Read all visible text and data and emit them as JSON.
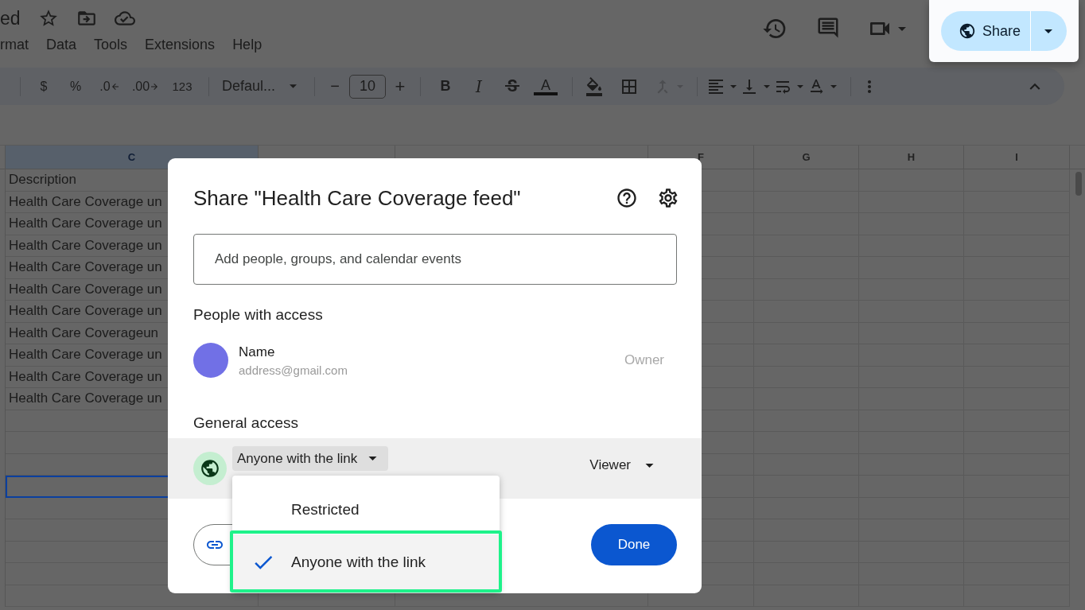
{
  "header": {
    "title": "ed",
    "menu": [
      "rmat",
      "Data",
      "Tools",
      "Extensions",
      "Help"
    ],
    "share_button": {
      "label": "Share"
    }
  },
  "toolbar": {
    "currency": "$",
    "percent": "%",
    "decrease_decimals": ".0",
    "increase_decimals": ".00",
    "number_format": "123",
    "font": "Defaul...",
    "minus": "−",
    "font_size": "10",
    "plus": "+",
    "bold": "B",
    "italic": "I",
    "text_color": "A"
  },
  "sheet": {
    "columns": [
      {
        "label": "C",
        "selected": true
      },
      {
        "selected": false
      },
      {
        "selected": false
      },
      {
        "label": "F",
        "selected": false
      },
      {
        "label": "G",
        "selected": false
      },
      {
        "label": "H",
        "selected": false
      },
      {
        "label": "I",
        "selected": false
      }
    ],
    "rows": [
      {
        "text": "Description",
        "selected": false
      },
      {
        "text": "Health Care Coverage un",
        "selected": false
      },
      {
        "text": "Health Care Coverage un",
        "selected": false
      },
      {
        "text": "Health Care Coverage un",
        "selected": false
      },
      {
        "text": "Health Care Coverage un",
        "selected": false
      },
      {
        "text": "Health Care Coverage un",
        "selected": false
      },
      {
        "text": "Health Care Coverage un",
        "selected": false
      },
      {
        "text": "Health Care Coverageun",
        "selected": false
      },
      {
        "text": "Health Care Coverage un",
        "selected": false
      },
      {
        "text": "Health Care Coverage un",
        "selected": false
      },
      {
        "text": "Health Care Coverage un",
        "selected": false
      },
      {
        "selected": false
      },
      {
        "selected": false
      },
      {
        "selected": false
      },
      {
        "selected": true
      },
      {
        "selected": false
      },
      {
        "selected": false
      },
      {
        "selected": false
      },
      {
        "selected": false
      },
      {
        "selected": false
      }
    ]
  },
  "dialog": {
    "title": "Share \"Health Care Coverage feed\"",
    "search": {
      "placeholder": "Add people, groups, and calendar events"
    },
    "people_heading": "People with access",
    "people": [
      {
        "name": "Name",
        "email": "address@gmail.com",
        "role": "Owner"
      }
    ],
    "general_heading": "General access",
    "access": {
      "value": "Anyone with the link",
      "role": "Viewer"
    },
    "menu": [
      {
        "label": "Restricted",
        "selected": false
      },
      {
        "label": "Anyone with the link",
        "selected": true
      }
    ],
    "done": "Done"
  }
}
